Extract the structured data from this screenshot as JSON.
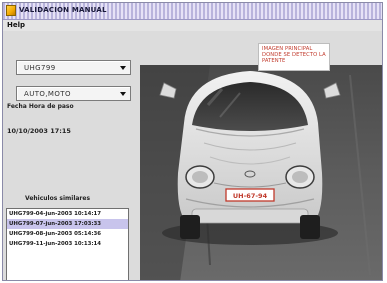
{
  "window": {
    "title": "VALIDACION MANUAL",
    "menu": {
      "help_label": "Help"
    }
  },
  "controls": {
    "plate_select": {
      "value": "UHG799"
    },
    "type_select": {
      "value": "AUTO,MOTO"
    }
  },
  "passage": {
    "datetime_label": "Fecha Hora de paso",
    "datetime_value": "10/10/2003 17:15"
  },
  "similar_vehicles": {
    "label": "Vehiculos similares",
    "items": [
      {
        "text": "UHG799-04-jun-2003 10:14:17",
        "selected": false
      },
      {
        "text": "UHG799-07-jun-2003 17:03:33",
        "selected": true
      },
      {
        "text": "UHG799-08-jun-2003 05:14:36",
        "selected": false
      },
      {
        "text": "UHG799-11-jun-2003 10:13:14",
        "selected": false
      }
    ]
  },
  "camera": {
    "caption": "IMAGEN PRINCIPAL DONDE SE DETECTO LA PATENTE",
    "plate_text": "UH-67-94",
    "colors": {
      "plate_border": "#c0392b",
      "caption_text": "#c0392b",
      "selection": "#c8c4ec"
    }
  }
}
